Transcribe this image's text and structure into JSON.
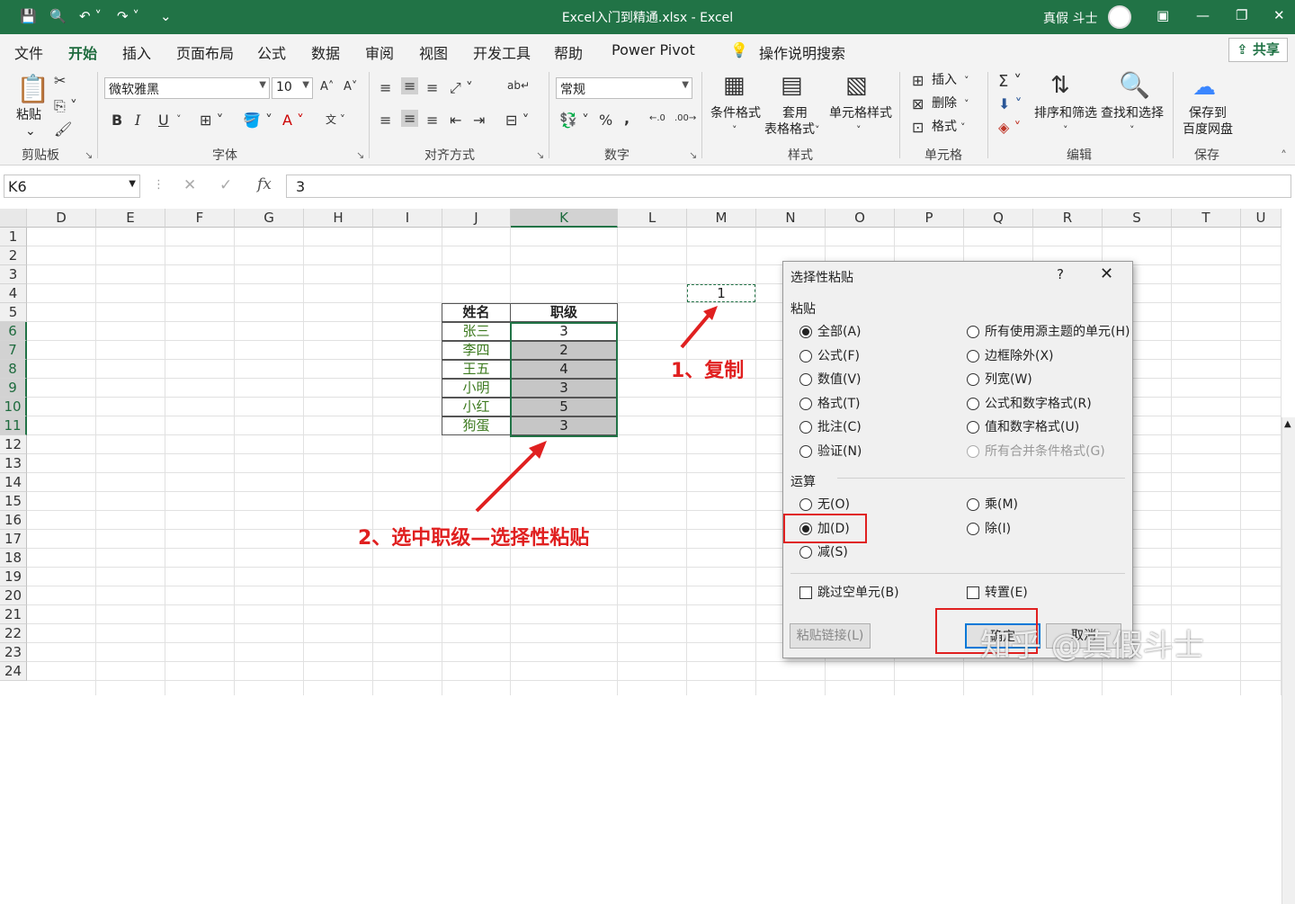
{
  "titlebar": {
    "title": "Excel入门到精通.xlsx  -  Excel",
    "user": "真假 斗士"
  },
  "menu": {
    "items": [
      "文件",
      "开始",
      "插入",
      "页面布局",
      "公式",
      "数据",
      "审阅",
      "视图",
      "开发工具",
      "帮助",
      "Power Pivot"
    ],
    "search": "操作说明搜索",
    "share": "共享"
  },
  "ribbon": {
    "clipboard": {
      "paste": "粘贴",
      "label": "剪贴板"
    },
    "font": {
      "name": "微软雅黑",
      "size": "10",
      "bold": "B",
      "italic": "I",
      "underline": "U",
      "label": "字体"
    },
    "align": {
      "label": "对齐方式"
    },
    "number": {
      "format": "常规",
      "percent": "%",
      "comma": ",",
      "label": "数字"
    },
    "styles": {
      "cond": "条件格式",
      "table_l1": "套用",
      "table_l2": "表格格式",
      "cell": "单元格样式",
      "label": "样式"
    },
    "cells": {
      "insert": "插入",
      "delete": "删除",
      "format": "格式",
      "label": "单元格"
    },
    "edit": {
      "sort": "排序和筛选",
      "find": "查找和选择",
      "label": "编辑"
    },
    "save": {
      "l1": "保存到",
      "l2": "百度网盘",
      "label": "保存"
    }
  },
  "formula": {
    "namebox": "K6",
    "value": "3"
  },
  "sheet": {
    "columns": [
      "D",
      "E",
      "F",
      "G",
      "H",
      "I",
      "J",
      "K",
      "L",
      "M",
      "N",
      "O",
      "P",
      "Q",
      "R",
      "S",
      "T",
      "U"
    ],
    "rows": [
      "1",
      "2",
      "3",
      "4",
      "5",
      "6",
      "7",
      "8",
      "9",
      "10",
      "11",
      "12",
      "13",
      "14",
      "15",
      "16",
      "17",
      "18",
      "19",
      "20",
      "21",
      "22",
      "23",
      "24"
    ],
    "copy_value": "1",
    "table": {
      "headers": [
        "姓名",
        "职级"
      ],
      "rows": [
        [
          "张三",
          "3"
        ],
        [
          "李四",
          "2"
        ],
        [
          "王五",
          "4"
        ],
        [
          "小明",
          "3"
        ],
        [
          "小红",
          "5"
        ],
        [
          "狗蛋",
          "3"
        ]
      ]
    }
  },
  "annotations": {
    "step1": "1、复制",
    "step2": "2、选中职级—选择性粘贴"
  },
  "dialog": {
    "title": "选择性粘贴",
    "help": "?",
    "paste_section": "粘贴",
    "paste_left": [
      "全部(A)",
      "公式(F)",
      "数值(V)",
      "格式(T)",
      "批注(C)",
      "验证(N)"
    ],
    "paste_right": [
      "所有使用源主题的单元(H)",
      "边框除外(X)",
      "列宽(W)",
      "公式和数字格式(R)",
      "值和数字格式(U)",
      "所有合并条件格式(G)"
    ],
    "op_section": "运算",
    "op_left": [
      "无(O)",
      "加(D)",
      "减(S)"
    ],
    "op_right": [
      "乘(M)",
      "除(I)"
    ],
    "skip_blanks": "跳过空单元(B)",
    "transpose": "转置(E)",
    "paste_link": "粘贴链接(L)",
    "ok": "确定",
    "cancel": "取消"
  },
  "watermark": "知乎 @真假斗士",
  "colors": {
    "excel_green": "#217346",
    "annotation_red": "#e02020",
    "name_green": "#3d7a1f"
  }
}
